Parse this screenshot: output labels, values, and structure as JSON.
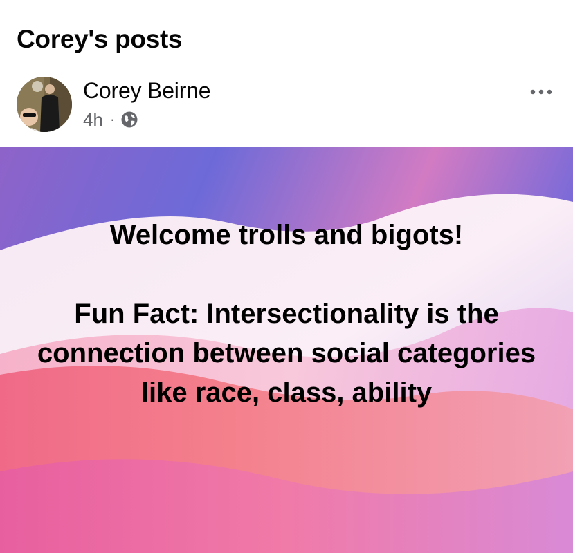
{
  "header": {
    "title": "Corey's posts"
  },
  "post": {
    "author": "Corey Beirne",
    "timestamp": "4h",
    "separator": "·",
    "privacy_icon": "globe-icon",
    "menu_icon": "more-options-icon",
    "body": {
      "line1": "Welcome trolls and bigots!",
      "line2": "Fun Fact: Intersectionality is the connection between social categories like race, class, ability"
    }
  },
  "colors": {
    "text_primary": "#050505",
    "text_secondary": "#65676b",
    "background_purple": "#6b63d8",
    "background_pink": "#f48ab8",
    "background_coral": "#f0707e"
  }
}
